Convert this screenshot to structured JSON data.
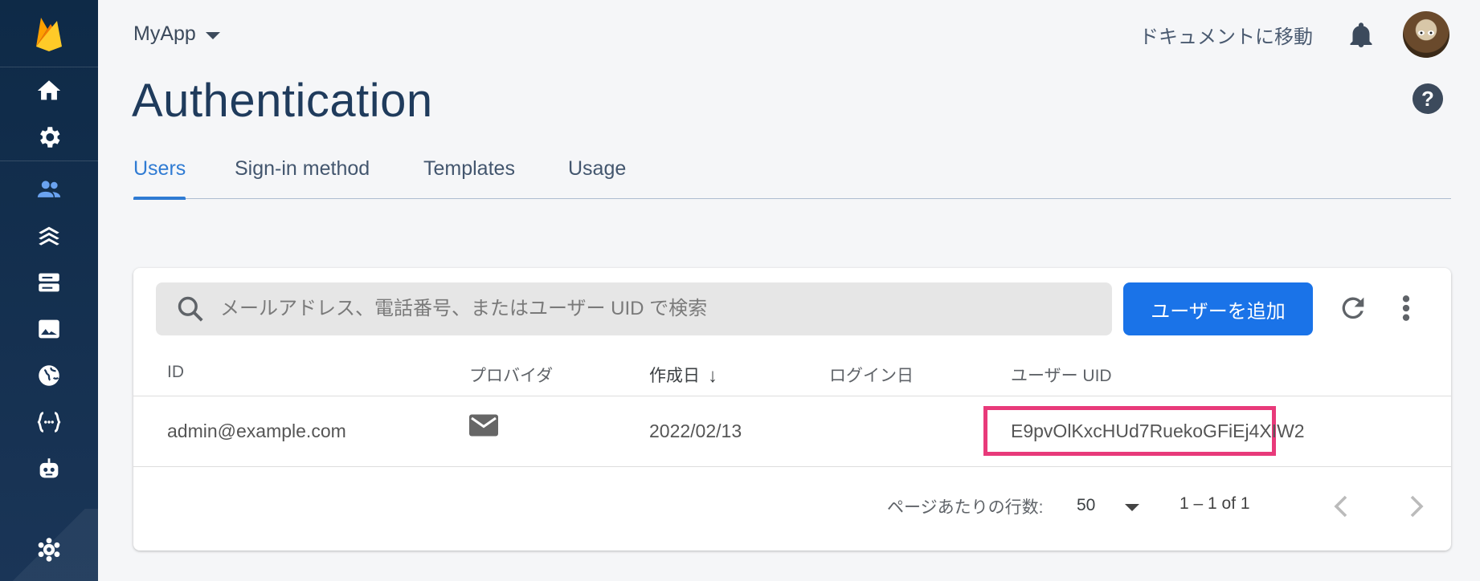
{
  "project": {
    "name": "MyApp"
  },
  "header": {
    "docs_link": "ドキュメントに移動"
  },
  "page": {
    "title": "Authentication"
  },
  "tabs": [
    {
      "label": "Users",
      "active": true
    },
    {
      "label": "Sign-in method",
      "active": false
    },
    {
      "label": "Templates",
      "active": false
    },
    {
      "label": "Usage",
      "active": false
    }
  ],
  "sidebar": {
    "icons": [
      "home-icon",
      "settings-icon",
      "users-icon",
      "extensions-icon",
      "database-icon",
      "storage-icon",
      "hosting-icon",
      "functions-icon",
      "ml-robot-icon",
      "extensions-gear-icon"
    ]
  },
  "search": {
    "placeholder": "メールアドレス、電話番号、またはユーザー UID で検索"
  },
  "toolbar": {
    "add_user_label": "ユーザーを追加"
  },
  "table": {
    "headers": {
      "id": "ID",
      "provider": "プロバイダ",
      "created": "作成日",
      "login": "ログイン日",
      "uid": "ユーザー UID"
    },
    "rows": [
      {
        "id": "admin@example.com",
        "provider": "mail-icon",
        "created": "2022/02/13",
        "login": "",
        "uid": "E9pvOlKxcHUd7RuekoGFiEj4XIW2"
      }
    ]
  },
  "pagination": {
    "rows_per_page_label": "ページあたりの行数:",
    "rows_per_page": "50",
    "range": "1 – 1 of 1"
  },
  "colors": {
    "primary": "#1a73e8",
    "highlight": "#e83a7a",
    "sidebar": "#0e2a47"
  }
}
